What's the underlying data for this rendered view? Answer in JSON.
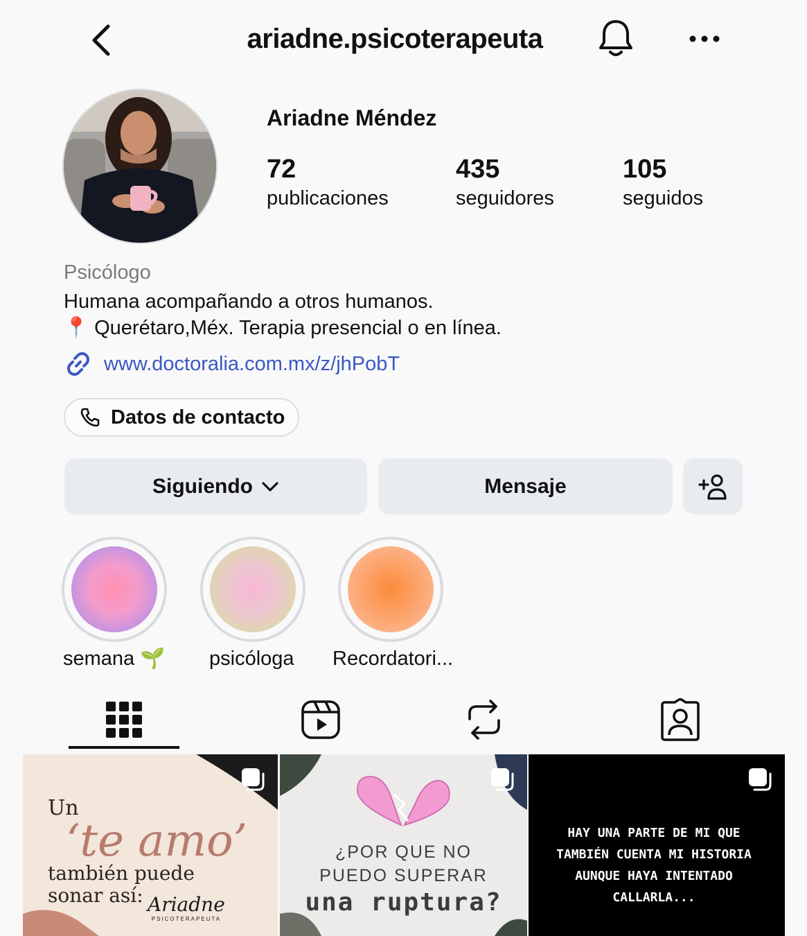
{
  "header": {
    "username": "ariadne.psicoterapeuta",
    "back_icon": "chevron-left-icon",
    "bell_icon": "bell-icon",
    "more_icon": "more-horizontal-icon"
  },
  "profile": {
    "display_name": "Ariadne Méndez",
    "stats": [
      {
        "value": "72",
        "label": "publicaciones"
      },
      {
        "value": "435",
        "label": "seguidores"
      },
      {
        "value": "105",
        "label": "seguidos"
      }
    ],
    "category": "Psicólogo",
    "bio_line1": "Humana acompañando a otros humanos.",
    "bio_line2_emoji": "📍",
    "bio_line2": "Querétaro,Méx. Terapia presencial o en línea.",
    "link": "www.doctoralia.com.mx/z/jhPobT",
    "contact_button": "Datos de contacto"
  },
  "actions": {
    "following": "Siguiendo",
    "message": "Mensaje",
    "add_user_icon": "add-user-icon"
  },
  "highlights": [
    {
      "label": "semana 🌱",
      "gradient_center": "#ff8fb0",
      "gradient_edge": "#9b8cf2"
    },
    {
      "label": "psicóloga",
      "gradient_center": "#f7b8d6",
      "gradient_edge": "#d6e29a"
    },
    {
      "label": "Recordatori...",
      "gradient_center": "#fb8c3a",
      "gradient_edge": "#fcc1a4"
    }
  ],
  "tabs": [
    {
      "name": "grid-icon",
      "active": true
    },
    {
      "name": "reels-icon",
      "active": false
    },
    {
      "name": "reposts-icon",
      "active": false
    },
    {
      "name": "tagged-icon",
      "active": false
    }
  ],
  "posts": [
    {
      "line1": "Un",
      "line2": "‘te amo’",
      "line3": "también puede",
      "line4": "sonar así:",
      "signature": "Ariadne",
      "signature_sub": "PSICOTERAPEUTA"
    },
    {
      "line1": "¿POR QUE NO",
      "line2": "PUEDO SUPERAR",
      "line3": "una ruptura?"
    },
    {
      "line1": "HAY UNA PARTE DE MI QUE",
      "line2": "TAMBIÉN CUENTA MI HISTORIA",
      "line3": "AUNQUE HAYA INTENTADO",
      "line4": "CALLARLA..."
    }
  ]
}
